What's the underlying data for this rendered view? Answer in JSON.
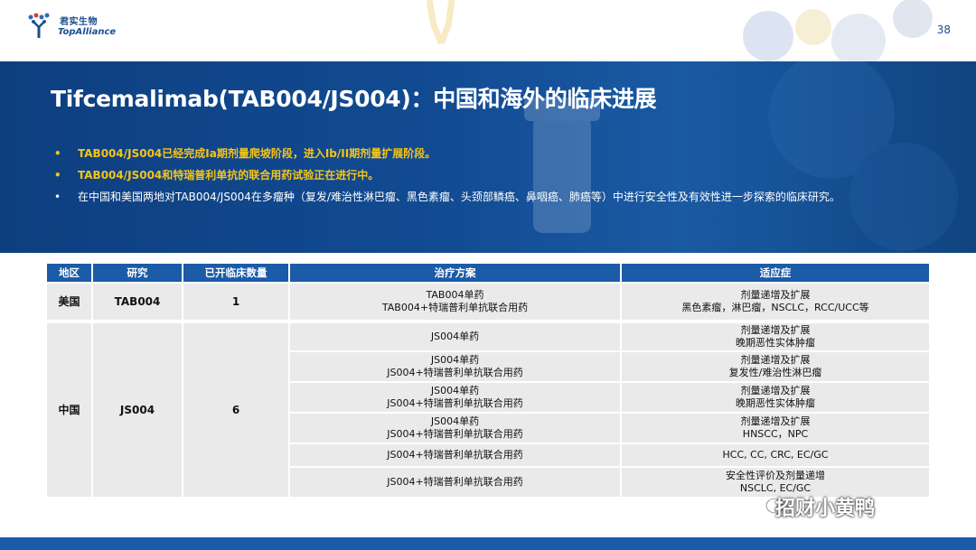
{
  "header": {
    "logo_cn": "君实生物",
    "logo_en": "TopAlliance",
    "page_number": "38"
  },
  "title": "Tifcemalimab(TAB004/JS004)：中国和海外的临床进展",
  "bullets": [
    "TAB004/JS004已经完成Ia期剂量爬坡阶段，进入Ib/II期剂量扩展阶段。",
    "TAB004/JS004和特瑞普利单抗的联合用药试验正在进行中。",
    "在中国和美国两地对TAB004/JS004在多瘤种（复发/难治性淋巴瘤、黑色素瘤、头颈部鳞癌、鼻咽癌、肺癌等）中进行安全性及有效性进一步探索的临床研究。"
  ],
  "table": {
    "headers": [
      "地区",
      "研究",
      "已开临床数量",
      "治疗方案",
      "适应症"
    ],
    "us": {
      "region": "美国",
      "study": "TAB004",
      "count": "1",
      "plan": [
        "TAB004单药",
        "TAB004+特瑞普利单抗联合用药"
      ],
      "indication": [
        "剂量递增及扩展",
        "黑色素瘤，淋巴瘤，NSCLC，RCC/UCC等"
      ]
    },
    "cn": {
      "region": "中国",
      "study": "JS004",
      "count": "6",
      "rows": [
        {
          "plan": [
            "JS004单药"
          ],
          "indication": [
            "剂量递增及扩展",
            "晚期恶性实体肿瘤"
          ]
        },
        {
          "plan": [
            "JS004单药",
            "JS004+特瑞普利单抗联合用药"
          ],
          "indication": [
            "剂量递增及扩展",
            "复发性/难治性淋巴瘤"
          ]
        },
        {
          "plan": [
            "JS004单药",
            "JS004+特瑞普利单抗联合用药"
          ],
          "indication": [
            "剂量递增及扩展",
            "晚期恶性实体肿瘤"
          ]
        },
        {
          "plan": [
            "JS004单药",
            "JS004+特瑞普利单抗联合用药"
          ],
          "indication": [
            "剂量递增及扩展",
            "HNSCC，NPC"
          ]
        },
        {
          "plan": [
            "JS004+特瑞普利单抗联合用药"
          ],
          "indication": [
            "HCC, CC, CRC, EC/GC"
          ]
        },
        {
          "plan": [
            "JS004+特瑞普利单抗联合用药"
          ],
          "indication": [
            "安全性评价及剂量递增",
            "NSCLC, EC/GC"
          ]
        }
      ]
    }
  },
  "watermark": "招财小黄鸭",
  "colors": {
    "banner": "#124b92",
    "highlight": "#f5c518",
    "table_header": "#1b5ba8",
    "cell_bg": "#eaeaea"
  }
}
